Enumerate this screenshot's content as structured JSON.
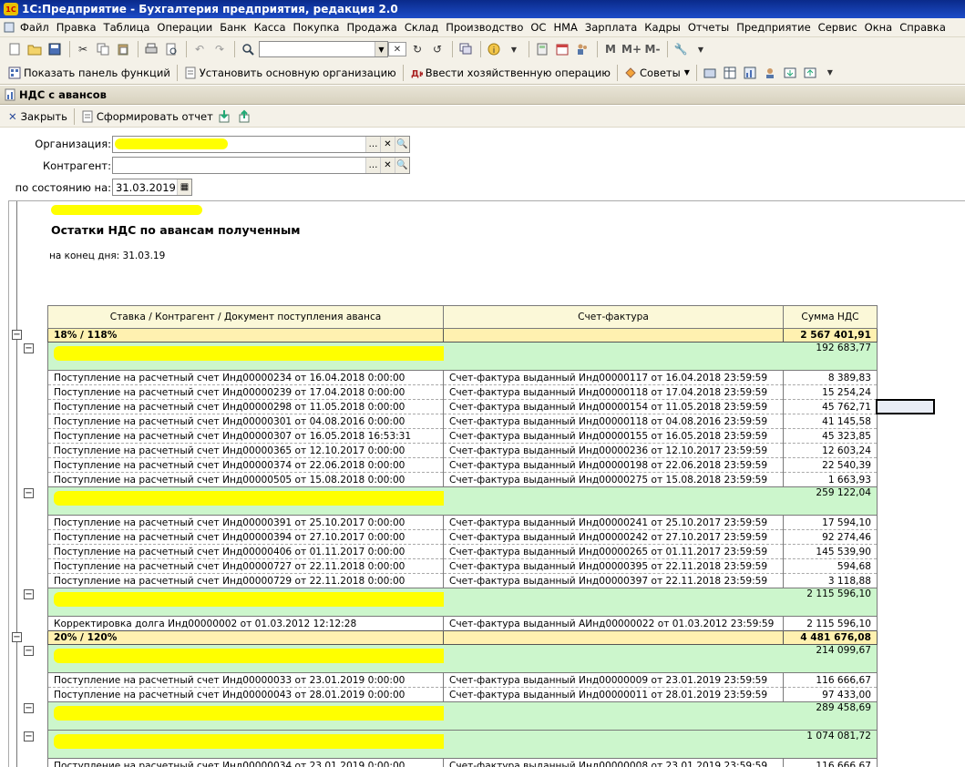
{
  "titlebar": {
    "logo": "1С",
    "title": "1С:Предприятие - Бухгалтерия предприятия, редакция 2.0"
  },
  "menu": [
    "Файл",
    "Правка",
    "Таблица",
    "Операции",
    "Банк",
    "Касса",
    "Покупка",
    "Продажа",
    "Склад",
    "Производство",
    "ОС",
    "НМА",
    "Зарплата",
    "Кадры",
    "Отчеты",
    "Предприятие",
    "Сервис",
    "Окна",
    "Справка"
  ],
  "toolbar2": {
    "show_panel": "Показать панель функций",
    "set_org": "Установить основную организацию",
    "enter_op": "Ввести хозяйственную операцию",
    "tips": "Советы"
  },
  "doc": {
    "title": "НДС с авансов",
    "close": "Закрыть",
    "make_report": "Сформировать отчет"
  },
  "form": {
    "org_label": "Организация:",
    "contr_label": "Контрагент:",
    "date_label": "по состоянию на:",
    "date_value": "31.03.2019"
  },
  "report": {
    "title": "Остатки НДС по авансам полученным",
    "subtitle": "на конец дня: 31.03.19",
    "columns": [
      "Ставка / Контрагент / Документ поступления аванса",
      "Счет-фактура",
      "Сумма НДС"
    ],
    "rows": [
      {
        "type": "rate",
        "c1": "18% / 118%",
        "c2": "",
        "c3": "2 567 401,91"
      },
      {
        "type": "grp",
        "c1": "",
        "c2": "",
        "c3": "192 683,77"
      },
      {
        "type": "doc",
        "c1": "Поступление на расчетный счет Инд00000234 от 16.04.2018 0:00:00",
        "c2": "Счет-фактура выданный Инд00000117 от 16.04.2018 23:59:59",
        "c3": "8 389,83"
      },
      {
        "type": "doc",
        "c1": "Поступление на расчетный счет Инд00000239 от 17.04.2018 0:00:00",
        "c2": "Счет-фактура выданный Инд00000118 от 17.04.2018 23:59:59",
        "c3": "15 254,24"
      },
      {
        "type": "doc",
        "c1": "Поступление на расчетный счет Инд00000298 от 11.05.2018 0:00:00",
        "c2": "Счет-фактура выданный Инд00000154 от 11.05.2018 23:59:59",
        "c3": "45 762,71"
      },
      {
        "type": "doc",
        "c1": "Поступление на расчетный счет Инд00000301 от 04.08.2016 0:00:00",
        "c2": "Счет-фактура выданный Инд00000118 от 04.08.2016 23:59:59",
        "c3": "41 145,58"
      },
      {
        "type": "doc",
        "c1": "Поступление на расчетный счет Инд00000307 от 16.05.2018 16:53:31",
        "c2": "Счет-фактура выданный Инд00000155 от 16.05.2018 23:59:59",
        "c3": "45 323,85"
      },
      {
        "type": "doc",
        "c1": "Поступление на расчетный счет Инд00000365 от 12.10.2017 0:00:00",
        "c2": "Счет-фактура выданный Инд00000236 от 12.10.2017 23:59:59",
        "c3": "12 603,24"
      },
      {
        "type": "doc",
        "c1": "Поступление на расчетный счет Инд00000374 от 22.06.2018 0:00:00",
        "c2": "Счет-фактура выданный Инд00000198 от 22.06.2018 23:59:59",
        "c3": "22 540,39"
      },
      {
        "type": "doc",
        "c1": "Поступление на расчетный счет Инд00000505 от 15.08.2018 0:00:00",
        "c2": "Счет-фактура выданный Инд00000275 от 15.08.2018 23:59:59",
        "c3": "1 663,93"
      },
      {
        "type": "grp",
        "c1": "",
        "c2": "",
        "c3": "259 122,04"
      },
      {
        "type": "doc",
        "c1": "Поступление на расчетный счет Инд00000391 от 25.10.2017 0:00:00",
        "c2": "Счет-фактура выданный Инд00000241 от 25.10.2017 23:59:59",
        "c3": "17 594,10"
      },
      {
        "type": "doc",
        "c1": "Поступление на расчетный счет Инд00000394 от 27.10.2017 0:00:00",
        "c2": "Счет-фактура выданный Инд00000242 от 27.10.2017 23:59:59",
        "c3": "92 274,46"
      },
      {
        "type": "doc",
        "c1": "Поступление на расчетный счет Инд00000406 от 01.11.2017 0:00:00",
        "c2": "Счет-фактура выданный Инд00000265 от 01.11.2017 23:59:59",
        "c3": "145 539,90"
      },
      {
        "type": "doc",
        "c1": "Поступление на расчетный счет Инд00000727 от 22.11.2018 0:00:00",
        "c2": "Счет-фактура выданный Инд00000395 от 22.11.2018 23:59:59",
        "c3": "594,68"
      },
      {
        "type": "doc",
        "c1": "Поступление на расчетный счет Инд00000729 от 22.11.2018 0:00:00",
        "c2": "Счет-фактура выданный Инд00000397 от 22.11.2018 23:59:59",
        "c3": "3 118,88"
      },
      {
        "type": "grp",
        "c1": "",
        "c2": "",
        "c3": "2 115 596,10"
      },
      {
        "type": "doc",
        "c1": "Корректировка долга Инд00000002 от 01.03.2012 12:12:28",
        "c2": "Счет-фактура выданный АИнд00000022 от 01.03.2012 23:59:59",
        "c3": "2 115 596,10"
      },
      {
        "type": "rate",
        "c1": "20% / 120%",
        "c2": "",
        "c3": "4 481 676,08"
      },
      {
        "type": "grp",
        "c1": "",
        "c2": "",
        "c3": "214 099,67"
      },
      {
        "type": "doc",
        "c1": "Поступление на расчетный счет Инд00000033 от 23.01.2019 0:00:00",
        "c2": "Счет-фактура выданный Инд00000009 от 23.01.2019 23:59:59",
        "c3": "116 666,67"
      },
      {
        "type": "doc",
        "c1": "Поступление на расчетный счет Инд00000043 от 28.01.2019 0:00:00",
        "c2": "Счет-фактура выданный Инд00000011 от 28.01.2019 23:59:59",
        "c3": "97 433,00"
      },
      {
        "type": "grp",
        "c1": "",
        "c2": "",
        "c3": "289 458,69"
      },
      {
        "type": "grp",
        "c1": "",
        "c2": "",
        "c3": "1 074 081,72"
      },
      {
        "type": "doc",
        "c1": "Поступление на расчетный счет Инд00000034 от 23.01.2019 0:00:00",
        "c2": "Счет-фактура выданный Инд00000008 от 23.01.2019 23:59:59",
        "c3": "116 666,67"
      }
    ]
  }
}
